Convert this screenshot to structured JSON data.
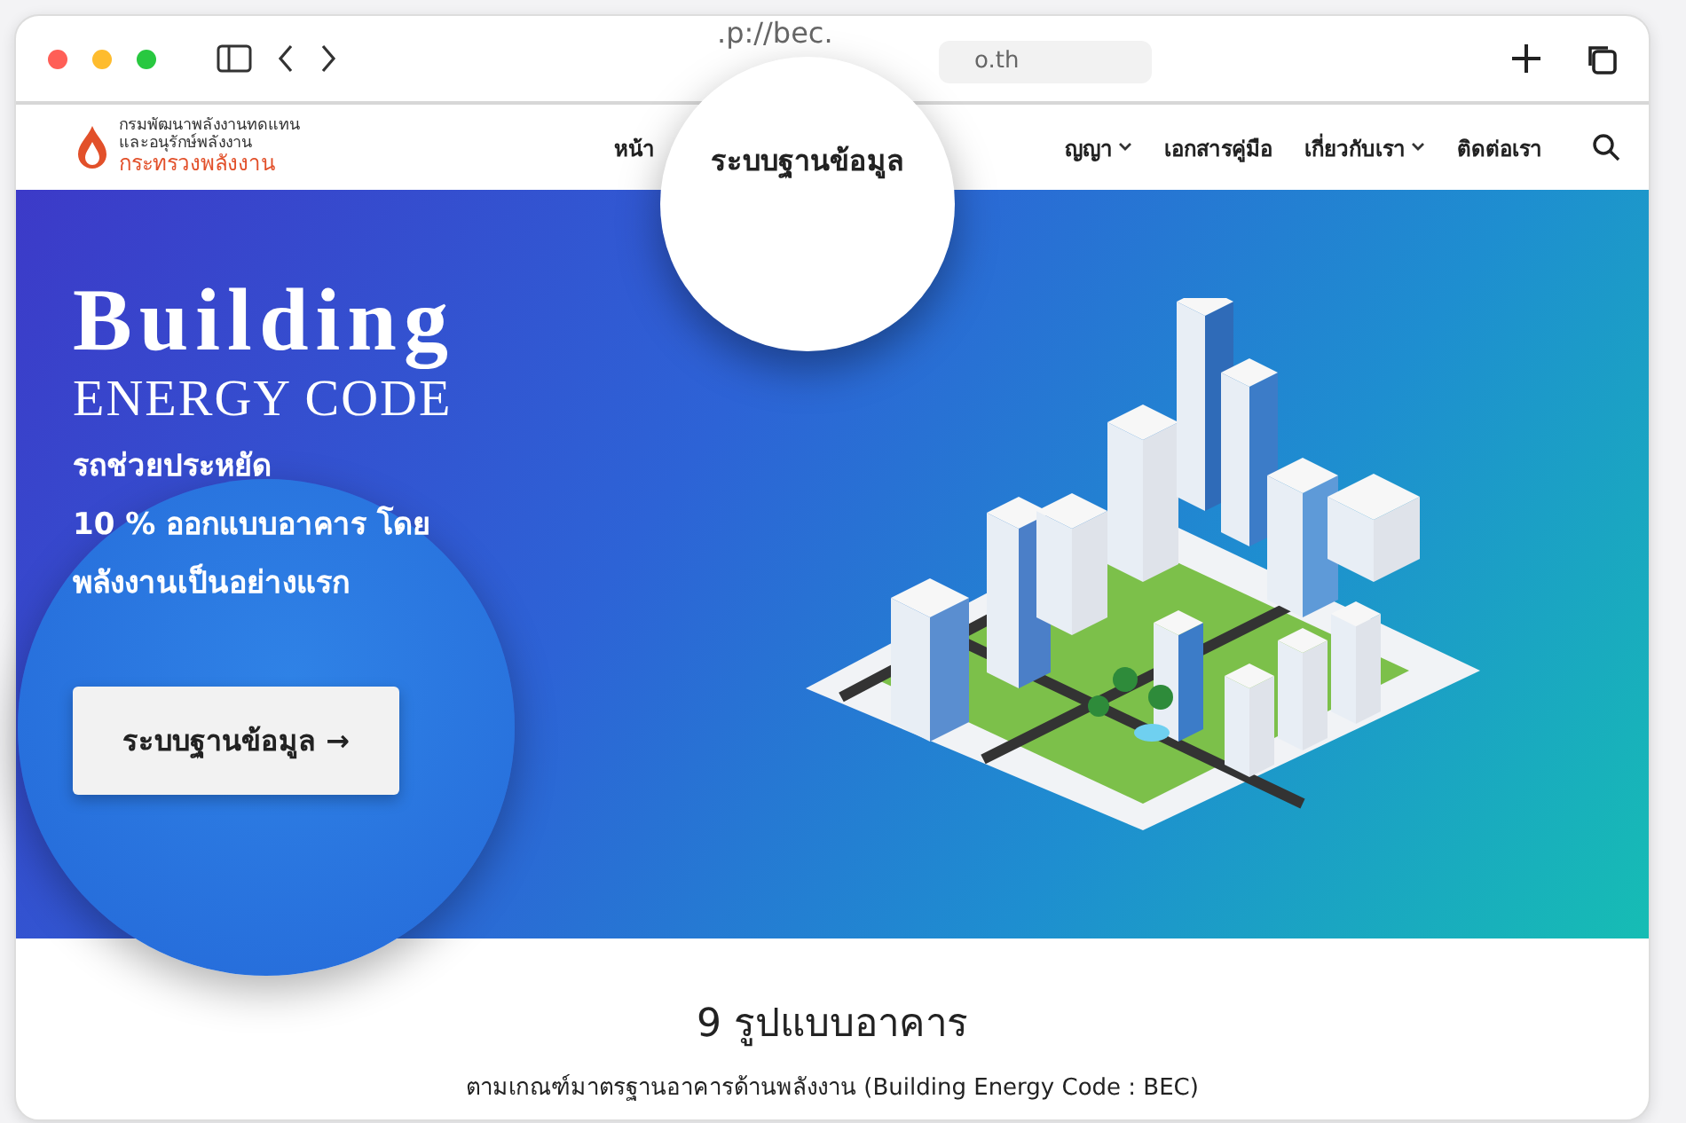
{
  "browser": {
    "url_parts": [
      ".p://bec.",
      "o.th"
    ]
  },
  "site_header": {
    "logo_lines": [
      "กรมพัฒนาพลังงานทดแทน",
      "และอนุรักษ์พลังงาน",
      "กระทรวงพลังงาน"
    ],
    "nav": [
      {
        "label": "หน้า",
        "dropdown": false
      },
      {
        "label": "ญญา",
        "dropdown": true
      },
      {
        "label": "เอกสารคู่มือ",
        "dropdown": false
      },
      {
        "label": "เกี่ยวกับเรา",
        "dropdown": true
      },
      {
        "label": "ติดต่อเรา",
        "dropdown": false
      }
    ],
    "magnified_nav_item": "ระบบฐานข้อมูล"
  },
  "hero": {
    "title": "Building",
    "subtitle": "ENERGY CODE",
    "lines": [
      "รถช่วยประหยัด",
      "10 % ออกแบบอาคาร โดย",
      "พลังงานเป็นอย่างแรก"
    ],
    "button": "ระบบฐานข้อมูล →"
  },
  "section": {
    "title": "9 รูปแบบอาคาร",
    "subtitle": "ตามเกณฑ์มาตรฐานอาคารด้านพลังงาน (Building Energy Code : BEC)"
  }
}
